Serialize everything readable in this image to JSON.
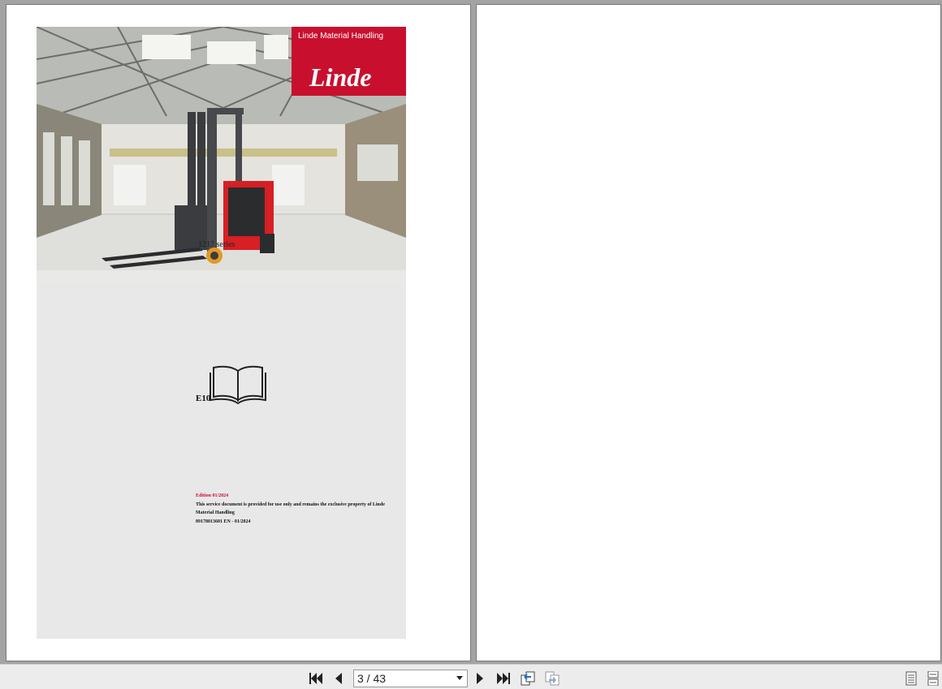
{
  "cover": {
    "brand_text": "Linde Material Handling",
    "logo_text": "Linde",
    "series": "1217 series",
    "model": "E10",
    "edition": "Edition 01/2024",
    "notice": "This service document is provided for use only and remains the exclusive property of Linde Material Handling",
    "doc_number": "89178013601 EN - 01/2024"
  },
  "toolbar": {
    "page_indicator": "3 / 43",
    "icons": [
      "first-page-icon",
      "previous-page-icon",
      "page-dropdown-icon",
      "next-page-icon",
      "last-page-icon",
      "go-back-view-icon",
      "go-forward-view-icon",
      "single-page-view-icon",
      "continuous-view-icon"
    ]
  },
  "colors": {
    "brand_red": "#c8102e",
    "viewer_bg": "#a3a3a3",
    "toolbar_bg": "#ececec",
    "cover_bg": "#e8e8e8"
  }
}
